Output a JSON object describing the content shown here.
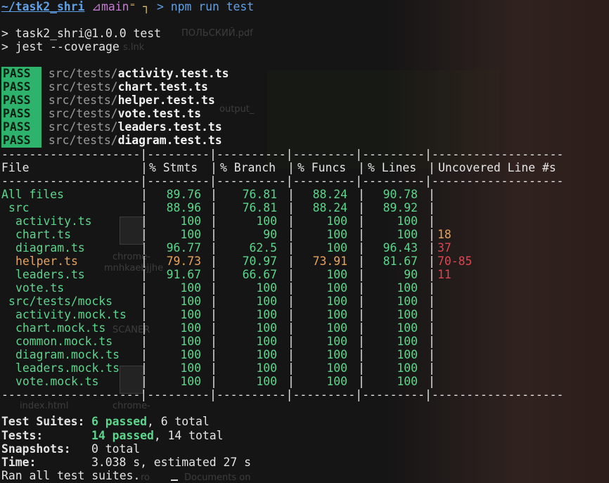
{
  "prompt": {
    "path": "~/task2_shri",
    "branch_icon": "⊿",
    "branch": "main",
    "branch_suffix": "⁼ ┐",
    "arrow": ">",
    "command": "npm run test"
  },
  "script_lines": [
    "> task2_shri@1.0.0 test",
    "> jest --coverage"
  ],
  "pass_label": "PASS",
  "tests": [
    {
      "dir": "src/tests/",
      "file": "activity.test.ts"
    },
    {
      "dir": "src/tests/",
      "file": "chart.test.ts"
    },
    {
      "dir": "src/tests/",
      "file": "helper.test.ts"
    },
    {
      "dir": "src/tests/",
      "file": "vote.test.ts"
    },
    {
      "dir": "src/tests/",
      "file": "leaders.test.ts"
    },
    {
      "dir": "src/tests/",
      "file": "diagram.test.ts"
    }
  ],
  "coverage": {
    "separator": "--------------------|---------|----------|---------|---------|-------------------",
    "headers": [
      "File",
      "% Stmts",
      "% Branch",
      "% Funcs",
      "% Lines",
      "Uncovered Line #s"
    ],
    "rows": [
      {
        "name": "All files",
        "indent": 0,
        "stmts": "89.76",
        "branch": "76.81",
        "funcs": "88.24",
        "lines": "90.78",
        "uncovered": "",
        "color": "green"
      },
      {
        "name": "src",
        "indent": 1,
        "stmts": "88.96",
        "branch": "76.81",
        "funcs": "88.24",
        "lines": "89.92",
        "uncovered": "",
        "color": "green"
      },
      {
        "name": "activity.ts",
        "indent": 2,
        "stmts": "100",
        "branch": "100",
        "funcs": "100",
        "lines": "100",
        "uncovered": "",
        "color": "green"
      },
      {
        "name": "chart.ts",
        "indent": 2,
        "stmts": "100",
        "branch": "90",
        "funcs": "100",
        "lines": "100",
        "uncovered": "18",
        "color": "green",
        "uncovered_color": "orange"
      },
      {
        "name": "diagram.ts",
        "indent": 2,
        "stmts": "96.77",
        "branch": "62.5",
        "funcs": "100",
        "lines": "96.43",
        "uncovered": "37",
        "color": "green",
        "uncovered_color": "red"
      },
      {
        "name": "helper.ts",
        "indent": 2,
        "stmts": "79.73",
        "branch": "70.97",
        "funcs": "73.91",
        "lines": "81.67",
        "uncovered": "70-85",
        "color": "mixed",
        "uncovered_color": "red"
      },
      {
        "name": "leaders.ts",
        "indent": 2,
        "stmts": "91.67",
        "branch": "66.67",
        "funcs": "100",
        "lines": "90",
        "uncovered": "11",
        "color": "green",
        "uncovered_color": "red"
      },
      {
        "name": "vote.ts",
        "indent": 2,
        "stmts": "100",
        "branch": "100",
        "funcs": "100",
        "lines": "100",
        "uncovered": "",
        "color": "green"
      },
      {
        "name": "src/tests/mocks",
        "indent": 1,
        "stmts": "100",
        "branch": "100",
        "funcs": "100",
        "lines": "100",
        "uncovered": "",
        "color": "green"
      },
      {
        "name": "activity.mock.ts",
        "indent": 2,
        "stmts": "100",
        "branch": "100",
        "funcs": "100",
        "lines": "100",
        "uncovered": "",
        "color": "green"
      },
      {
        "name": "chart.mock.ts",
        "indent": 2,
        "stmts": "100",
        "branch": "100",
        "funcs": "100",
        "lines": "100",
        "uncovered": "",
        "color": "green"
      },
      {
        "name": "common.mock.ts",
        "indent": 2,
        "stmts": "100",
        "branch": "100",
        "funcs": "100",
        "lines": "100",
        "uncovered": "",
        "color": "green"
      },
      {
        "name": "diagram.mock.ts",
        "indent": 2,
        "stmts": "100",
        "branch": "100",
        "funcs": "100",
        "lines": "100",
        "uncovered": "",
        "color": "green"
      },
      {
        "name": "leaders.mock.ts",
        "indent": 2,
        "stmts": "100",
        "branch": "100",
        "funcs": "100",
        "lines": "100",
        "uncovered": "",
        "color": "green"
      },
      {
        "name": "vote.mock.ts",
        "indent": 2,
        "stmts": "100",
        "branch": "100",
        "funcs": "100",
        "lines": "100",
        "uncovered": "",
        "color": "green"
      }
    ]
  },
  "summary": {
    "suites_label": "Test Suites:",
    "suites_passed": "6 passed",
    "suites_total": ", 6 total",
    "tests_label": "Tests:",
    "tests_passed": "14 passed",
    "tests_total": ", 14 total",
    "snapshots_label": "Snapshots:",
    "snapshots_value": "0 total",
    "time_label": "Time:",
    "time_value": "3.038 s, estimated 27 s",
    "final": "Ran all test suites."
  },
  "background_desktop": {
    "labels": [
      "ПОЛЬСКИЙ.pdf",
      "s.lnk",
      "output_",
      "chrome-",
      "mnhkaebjjhe",
      "SCANER",
      "index.html",
      "chrome-",
      "Documents on",
      "ro"
    ]
  },
  "colors": {
    "green": "#5cd68c",
    "red": "#e0444f",
    "orange": "#e8a25a",
    "yellow": "#e0c070",
    "blue": "#5fa0e6",
    "pass_bg": "#2db36b"
  }
}
